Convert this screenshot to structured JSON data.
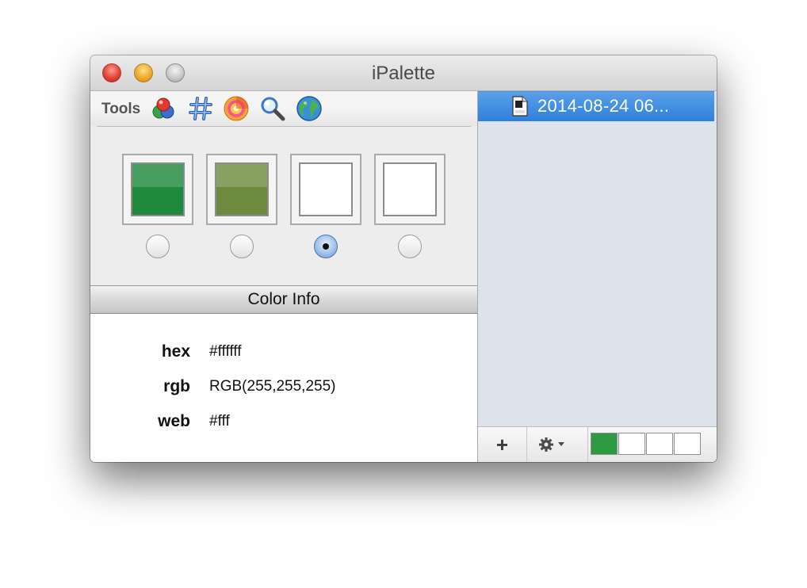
{
  "window": {
    "title": "iPalette"
  },
  "toolbar": {
    "label": "Tools",
    "tools": [
      {
        "icon": "color-balls-icon"
      },
      {
        "icon": "hash-icon"
      },
      {
        "icon": "color-wheel-icon"
      },
      {
        "icon": "magnifier-icon"
      },
      {
        "icon": "globe-icon"
      }
    ]
  },
  "swatches": [
    {
      "color": "#1f8a3c",
      "selected": false
    },
    {
      "color": "#6e8b3d",
      "selected": false
    },
    {
      "color": "#ffffff",
      "selected": true
    },
    {
      "color": "#ffffff",
      "selected": false
    }
  ],
  "color_info": {
    "header": "Color Info",
    "rows": [
      {
        "key": "hex",
        "value": "#ffffff"
      },
      {
        "key": "rgb",
        "value": "RGB(255,255,255)"
      },
      {
        "key": "web",
        "value": "#fff"
      }
    ]
  },
  "documents": [
    {
      "label": "2014-08-24 06...",
      "icon": "cpp-file-icon",
      "selected": true
    }
  ],
  "bottombar": {
    "add_label": "+",
    "gear_icon": "gear-icon",
    "mini_swatches": [
      "#2e9a44",
      "#ffffff",
      "#ffffff",
      "#ffffff"
    ]
  },
  "colors": {
    "selection_blue": "#3584e0",
    "sidebar_bg": "#dde3ea"
  }
}
